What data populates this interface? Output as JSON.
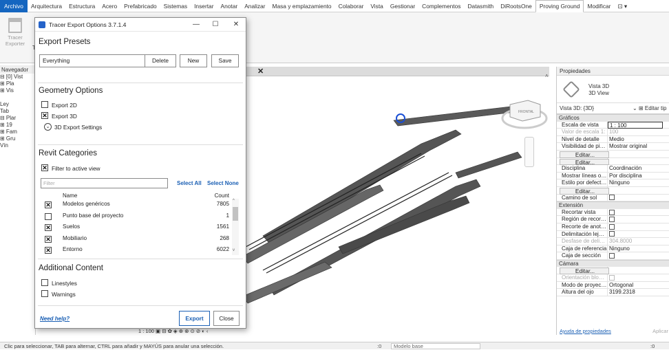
{
  "ribbon": {
    "tabs": [
      "Archivo",
      "Arquitectura",
      "Estructura",
      "Acero",
      "Prefabricado",
      "Sistemas",
      "Insertar",
      "Anotar",
      "Analizar",
      "Masa y emplazamiento",
      "Colaborar",
      "Vista",
      "Gestionar",
      "Complementos",
      "Datasmith",
      "DiRootsOne",
      "Proving Ground",
      "Modificar"
    ],
    "active_tab": "Proving Ground",
    "tracer_tool": "Tracer Exporter",
    "panel_partial": "T"
  },
  "navigator": {
    "title": "Navegador",
    "rows": [
      "⊟ [0] Vist",
      "  ⊞ Pla",
      "  ⊞ Vis",
      "",
      "  Ley",
      "  Tab",
      "⊟ Plar",
      "  ⊞ 19",
      "⊞ Fam",
      "⊞ Gru",
      "  Vín"
    ]
  },
  "dialog": {
    "title": "Tracer Export Options  3.7.1.4",
    "minimize": "—",
    "maximize": "☐",
    "close": "✕",
    "export_presets": {
      "title": "Export Presets",
      "selected": "Everything",
      "delete": "Delete",
      "new": "New",
      "save": "Save"
    },
    "geometry": {
      "title": "Geometry Options",
      "export_2d": {
        "label": "Export 2D",
        "checked": false
      },
      "export_3d": {
        "label": "Export 3D",
        "checked": true
      },
      "settings": "3D Export Settings"
    },
    "categories": {
      "title": "Revit Categories",
      "filter_active": {
        "label": "Filter to active view",
        "checked": true
      },
      "filter_placeholder": "Filter",
      "select_all": "Select All",
      "select_none": "Select None",
      "col_name": "Name",
      "col_count": "Count",
      "rows": [
        {
          "name": "Modelos genéricos",
          "count": "7805",
          "checked": true
        },
        {
          "name": "Punto base del proyecto",
          "count": "1",
          "checked": false
        },
        {
          "name": "Suelos",
          "count": "1561",
          "checked": true
        },
        {
          "name": "Mobiliario",
          "count": "268",
          "checked": true
        },
        {
          "name": "Entorno",
          "count": "6022",
          "checked": true
        }
      ]
    },
    "additional": {
      "title": "Additional Content",
      "linestyles": {
        "label": "Linestyles",
        "checked": false
      },
      "warnings": {
        "label": "Warnings",
        "checked": false
      }
    },
    "help": "Need help?",
    "export": "Export",
    "close_btn": "Close"
  },
  "viewport": {
    "close": "✕",
    "viewcube_label": "FRONTAL",
    "scale": "1 : 100"
  },
  "properties": {
    "title": "Propiedades",
    "type_line1": "Vista 3D",
    "type_line2": "3D View",
    "selector": "Vista 3D: {3D}",
    "edit_type": "Editar tip",
    "groups": [
      {
        "name": "Gráficos",
        "rows": [
          {
            "k": "Escala de vista",
            "v": "1 : 100",
            "kind": "boxed"
          },
          {
            "k": "Valor de escala  1:",
            "v": "100",
            "kind": "dim"
          },
          {
            "k": "Nivel de detalle",
            "v": "Medio"
          },
          {
            "k": "Visibilidad de piezas",
            "v": "Mostrar original"
          },
          {
            "k": "Modificaciones de ...",
            "v": "Editar...",
            "kind": "btn"
          },
          {
            "k": "Opciones de visuali...",
            "v": "Editar...",
            "kind": "btn"
          },
          {
            "k": "Disciplina",
            "v": "Coordinación"
          },
          {
            "k": "Mostrar líneas ocul...",
            "v": "Por disciplina"
          },
          {
            "k": "Estilo por defecto ...",
            "v": "Ninguno"
          },
          {
            "k": "Mostrar rejillas",
            "v": "Editar...",
            "kind": "btn"
          },
          {
            "k": "Camino de sol",
            "v": "",
            "kind": "check"
          }
        ]
      },
      {
        "name": "Extensión",
        "rows": [
          {
            "k": "Recortar vista",
            "v": "",
            "kind": "check"
          },
          {
            "k": "Región de recorte ...",
            "v": "",
            "kind": "check"
          },
          {
            "k": "Recorte de anotaci...",
            "v": "",
            "kind": "check"
          },
          {
            "k": "Delimitación lejana...",
            "v": "",
            "kind": "check"
          },
          {
            "k": "Desfase de delimit...",
            "v": "304.8000",
            "kind": "dim"
          },
          {
            "k": "Caja de referencia",
            "v": "Ninguno"
          },
          {
            "k": "Caja de sección",
            "v": "",
            "kind": "check"
          }
        ]
      },
      {
        "name": "Cámara",
        "rows": [
          {
            "k": "Configuración de r...",
            "v": "Editar...",
            "kind": "btn"
          },
          {
            "k": "Orientación bloque...",
            "v": "",
            "kind": "dimcheck"
          },
          {
            "k": "Modo de proyección",
            "v": "Ortogonal"
          },
          {
            "k": "Altura del ojo",
            "v": "3199.2318"
          }
        ]
      }
    ],
    "help_link": "Ayuda de propiedades",
    "apply": "Aplicar"
  },
  "statusbar": {
    "message": "Clic para seleccionar, TAB para alternar, CTRL para añadir y MAYÚS para anular una selección.",
    "zero": ":0",
    "model": "Modelo base",
    "filter_count": ":0"
  },
  "colors": {
    "file_tab": "#1566c0",
    "link": "#1a5fb4",
    "dialog_icon": "#2563c9"
  }
}
